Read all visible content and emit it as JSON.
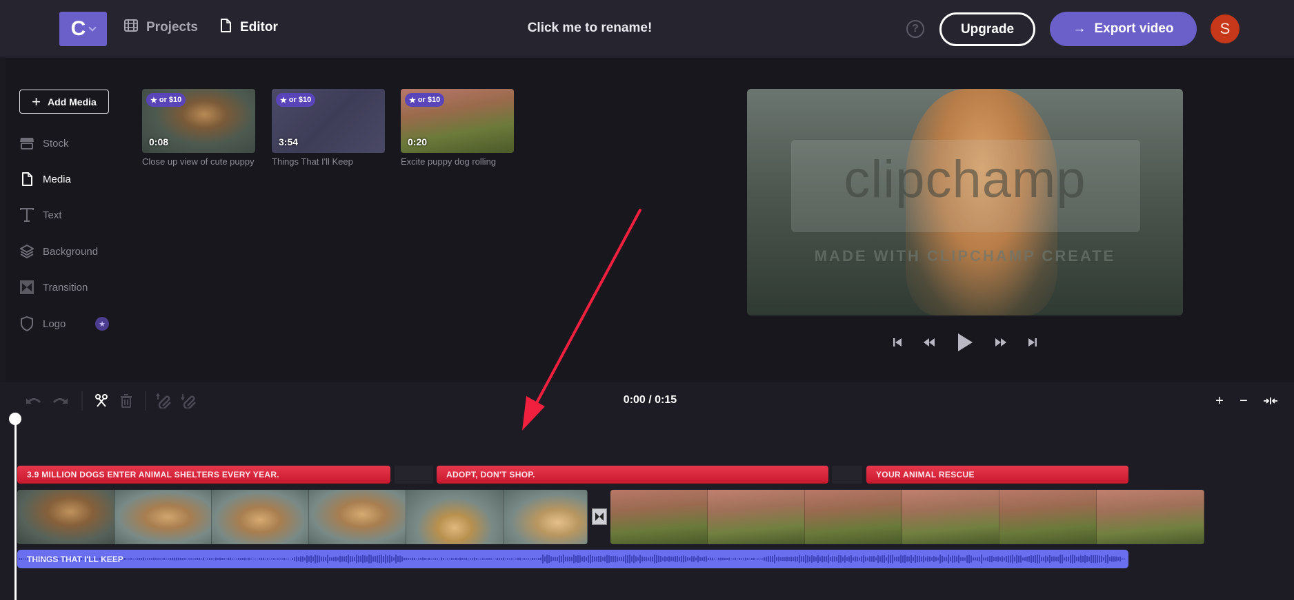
{
  "header": {
    "logo_letter": "C",
    "nav": [
      {
        "label": "Projects",
        "icon": "film-icon",
        "active": false
      },
      {
        "label": "Editor",
        "icon": "document-icon",
        "active": true
      }
    ],
    "project_title": "Click me to rename!",
    "help_glyph": "?",
    "upgrade_label": "Upgrade",
    "export_label": "Export video",
    "export_arrow": "→",
    "avatar_initial": "S"
  },
  "sidebar": {
    "add_media_label": "Add Media",
    "add_media_glyph": "+",
    "items": [
      {
        "label": "Stock",
        "icon": "store-icon",
        "active": false
      },
      {
        "label": "Media",
        "icon": "document-icon",
        "active": true
      },
      {
        "label": "Text",
        "icon": "text-icon",
        "active": false
      },
      {
        "label": "Background",
        "icon": "layers-icon",
        "active": false
      },
      {
        "label": "Transition",
        "icon": "transition-icon",
        "active": false
      },
      {
        "label": "Logo",
        "icon": "shield-icon",
        "active": false,
        "premium": true
      }
    ],
    "premium_glyph": "★"
  },
  "media": [
    {
      "badge": "or $10",
      "duration": "0:08",
      "caption": "Close up view of cute puppy",
      "kind": "video-puppy"
    },
    {
      "badge": "or $10",
      "duration": "3:54",
      "caption": "Things That I'll Keep",
      "kind": "audio"
    },
    {
      "badge": "or $10",
      "duration": "0:20",
      "caption": "Excite puppy dog rolling",
      "kind": "video-grass"
    }
  ],
  "media_badge_star": "★",
  "preview": {
    "watermark": "clipchamp",
    "watermark_sub": "MADE WITH CLIPCHAMP CREATE"
  },
  "playback": {
    "controls": [
      "skip-back",
      "rewind",
      "play",
      "fast-forward",
      "skip-end"
    ]
  },
  "timeline": {
    "timecode": "0:00 / 0:15",
    "zoom_in": "+",
    "zoom_out": "−",
    "fit": "→←",
    "text_clips": [
      {
        "label": "3.9 MILLION DOGS ENTER ANIMAL SHELTERS EVERY YEAR."
      },
      {
        "label": "ADOPT, DON'T SHOP."
      },
      {
        "label": "YOUR ANIMAL RESCUE"
      }
    ],
    "video_clips": [
      {
        "name": "puppy-closeup",
        "frames": 6
      },
      {
        "name": "puppy-grass",
        "frames": 6
      }
    ],
    "audio_clip": {
      "label": "THINGS THAT I'LL KEEP"
    }
  },
  "colors": {
    "accent": "#6b5fc9",
    "text_clip": "#d8243a",
    "audio_clip": "#6a6ff0",
    "avatar": "#c7381b",
    "annotation_arrow": "#f0203e"
  }
}
